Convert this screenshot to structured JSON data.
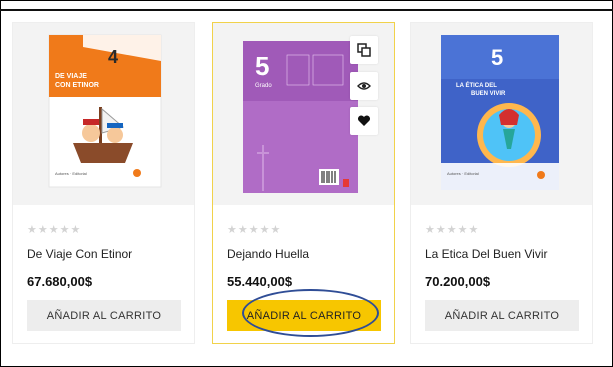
{
  "products": [
    {
      "name": "De Viaje Con Etinor",
      "price": "67.680,00$",
      "rating_stars": "★★★★★",
      "button_label": "AÑADIR AL CARRITO",
      "cover_grade": "4",
      "cover_title": "DE VIAJE CON ETINOR"
    },
    {
      "name": "Dejando Huella",
      "price": "55.440,00$",
      "rating_stars": "★★★★★",
      "button_label": "AÑADIR AL CARRITO",
      "cover_grade": "5",
      "cover_subtitle": "Grado"
    },
    {
      "name": "La Etica Del Buen Vivir",
      "price": "70.200,00$",
      "rating_stars": "★★★★★",
      "button_label": "AÑADIR AL CARRITO",
      "cover_grade": "5",
      "cover_title": "LA ÉTICA DEL BUEN VIVIR"
    }
  ],
  "quick_actions": [
    "compare-icon",
    "quick-view-icon",
    "wishlist-icon"
  ],
  "colors": {
    "accent": "#f7c600",
    "annotation": "#2f4d96",
    "star_empty": "#d3d3d3",
    "button_gray": "#ededed"
  }
}
